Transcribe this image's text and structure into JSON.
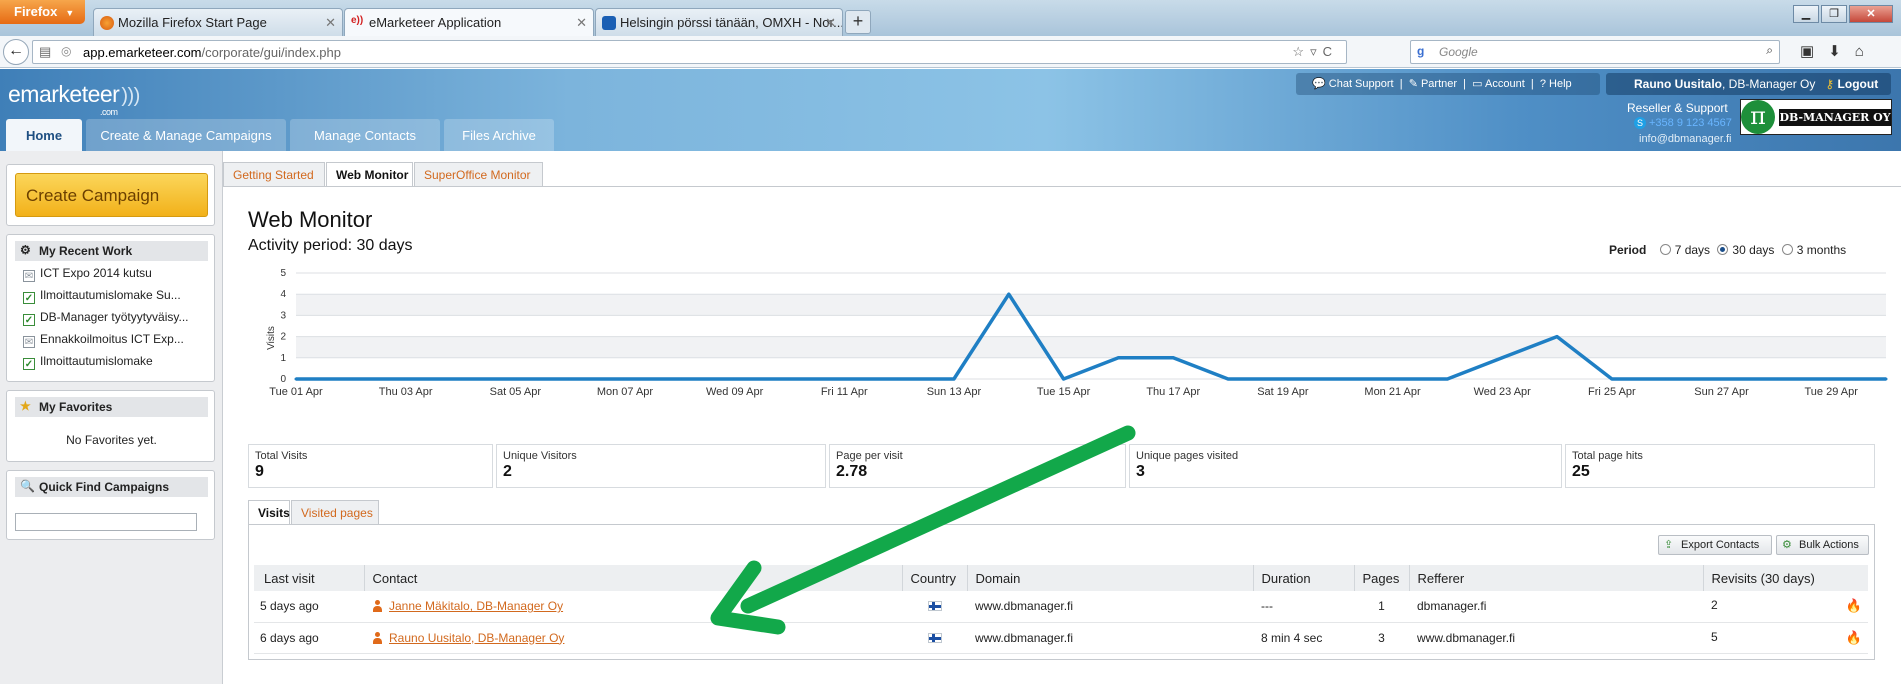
{
  "browser": {
    "menu_button": "Firefox",
    "tabs": [
      {
        "title": "Mozilla Firefox Start Page"
      },
      {
        "title": "eMarketeer Application"
      },
      {
        "title": "Helsingin pörssi tänään, OMXH - Nor..."
      }
    ],
    "url_host": "app.emarketeer.com",
    "url_path": "/corporate/gui/index.php",
    "search_placeholder": "Google"
  },
  "app": {
    "logo": "emarketeer",
    "logo_suffix": ".com",
    "nav": [
      {
        "label": "Home"
      },
      {
        "label": "Create & Manage Campaigns"
      },
      {
        "label": "Manage Contacts"
      },
      {
        "label": "Files Archive"
      }
    ],
    "top_links": {
      "chat": "Chat Support",
      "partner": "Partner",
      "account": "Account",
      "help": "Help"
    },
    "user": {
      "name": "Rauno Uusitalo",
      "company": ", DB-Manager Oy",
      "logout": "Logout"
    },
    "reseller": {
      "label": "Reseller & Support",
      "phone": "+358 9 123 4567",
      "email": "info@dbmanager.fi",
      "logo_text": "DB-MANAGER OY"
    }
  },
  "sidebar": {
    "create_campaign": "Create Campaign",
    "recent": {
      "title": "My Recent Work",
      "items": [
        {
          "label": "ICT Expo 2014 kutsu"
        },
        {
          "label": "Ilmoittautumislomake Su..."
        },
        {
          "label": "DB-Manager työtyytyväisy..."
        },
        {
          "label": "Ennakkoilmoitus ICT Exp..."
        },
        {
          "label": "Ilmoittautumislomake"
        }
      ]
    },
    "favorites": {
      "title": "My Favorites",
      "empty": "No Favorites yet."
    },
    "quick_find": {
      "title": "Quick Find Campaigns",
      "value": ""
    }
  },
  "page": {
    "tabs": [
      {
        "label": "Getting Started"
      },
      {
        "label": "Web Monitor"
      },
      {
        "label": "SuperOffice Monitor"
      }
    ],
    "title": "Web Monitor",
    "subtitle": "Activity period: 30 days",
    "period": {
      "label": "Period",
      "options": [
        "7 days",
        "30 days",
        "3 months"
      ],
      "selected": "30 days"
    },
    "stats": [
      {
        "label": "Total Visits",
        "value": "9"
      },
      {
        "label": "Unique Visitors",
        "value": "2"
      },
      {
        "label": "Page per visit",
        "value": "2.78"
      },
      {
        "label": "Unique pages visited",
        "value": "3"
      },
      {
        "label": "Total page hits",
        "value": "25"
      }
    ],
    "visit_tabs": [
      {
        "label": "Visits"
      },
      {
        "label": "Visited pages"
      }
    ],
    "actions": {
      "export": "Export Contacts",
      "bulk": "Bulk Actions"
    },
    "table": {
      "columns": [
        "Last visit",
        "Contact",
        "Country",
        "Domain",
        "Duration",
        "Pages",
        "Refferer",
        "Revisits (30 days)"
      ],
      "rows": [
        {
          "last_visit": "5 days ago",
          "contact": "Janne Mäkitalo, DB-Manager Oy",
          "domain": "www.dbmanager.fi",
          "duration": "---",
          "pages": "1",
          "referrer": "dbmanager.fi",
          "revisits": "2"
        },
        {
          "last_visit": "6 days ago",
          "contact": "Rauno Uusitalo, DB-Manager Oy",
          "domain": "www.dbmanager.fi",
          "duration": "8 min 4 sec",
          "pages": "3",
          "referrer": "www.dbmanager.fi",
          "revisits": "5"
        }
      ]
    }
  },
  "colors": {
    "line": "#1f7fc4",
    "annotation_arrow": "#12a84a",
    "link": "#d2691e"
  },
  "chart_data": {
    "type": "line",
    "ylabel": "Visits",
    "ylim": [
      0,
      5
    ],
    "yticks": [
      0,
      1,
      2,
      3,
      4,
      5
    ],
    "x": [
      "Tue 01 Apr",
      "Wed 02 Apr",
      "Thu 03 Apr",
      "Fri 04 Apr",
      "Sat 05 Apr",
      "Sun 06 Apr",
      "Mon 07 Apr",
      "Tue 08 Apr",
      "Wed 09 Apr",
      "Thu 10 Apr",
      "Fri 11 Apr",
      "Sat 12 Apr",
      "Sun 13 Apr",
      "Mon 14 Apr",
      "Tue 15 Apr",
      "Wed 16 Apr",
      "Thu 17 Apr",
      "Fri 18 Apr",
      "Sat 19 Apr",
      "Sun 20 Apr",
      "Mon 21 Apr",
      "Tue 22 Apr",
      "Wed 23 Apr",
      "Thu 24 Apr",
      "Fri 25 Apr",
      "Sat 26 Apr",
      "Sun 27 Apr",
      "Mon 28 Apr",
      "Tue 29 Apr",
      "Wed 30 Apr"
    ],
    "xticks": [
      "Tue 01 Apr",
      "Thu 03 Apr",
      "Sat 05 Apr",
      "Mon 07 Apr",
      "Wed 09 Apr",
      "Fri 11 Apr",
      "Sun 13 Apr",
      "Tue 15 Apr",
      "Thu 17 Apr",
      "Sat 19 Apr",
      "Mon 21 Apr",
      "Wed 23 Apr",
      "Fri 25 Apr",
      "Sun 27 Apr",
      "Tue 29 Apr"
    ],
    "values": [
      0,
      0,
      0,
      0,
      0,
      0,
      0,
      0,
      0,
      0,
      0,
      0,
      0,
      4,
      0,
      1,
      1,
      0,
      0,
      0,
      0,
      0,
      1,
      2,
      0,
      0,
      0,
      0,
      0,
      0
    ],
    "grid": true,
    "legend": "none"
  }
}
